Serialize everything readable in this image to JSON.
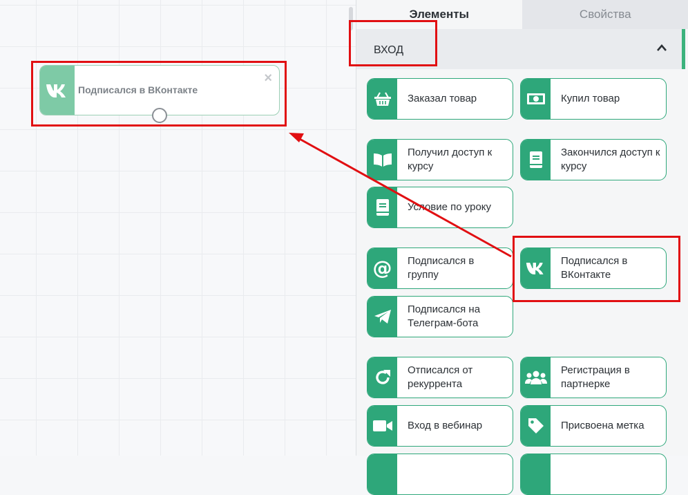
{
  "canvas": {
    "node": {
      "title": "Подписался в ВКонтакте",
      "icon": "vk-icon",
      "close": "×"
    }
  },
  "panel": {
    "tabs": [
      {
        "label": "Элементы",
        "active": true
      },
      {
        "label": "Свойства",
        "active": false
      }
    ],
    "section": {
      "title": "ВХОД",
      "chevron": "chevron-up-icon"
    },
    "cards": [
      {
        "label": "Заказал товар",
        "icon": "basket-icon"
      },
      {
        "label": "Купил товар",
        "icon": "money-icon"
      },
      {
        "label": "Получил доступ к курсу",
        "icon": "open-book-icon"
      },
      {
        "label": "Закончился доступ к курсу",
        "icon": "book-icon"
      },
      {
        "label": "Условие по уроку",
        "icon": "book-icon"
      },
      {
        "label": "Подписался в группу",
        "icon": "at-icon"
      },
      {
        "label": "Подписался в ВКонтакте",
        "icon": "vk-icon"
      },
      {
        "label": "Подписался на Телеграм-бота",
        "icon": "telegram-icon"
      },
      {
        "label": "Отписался от рекуррента",
        "icon": "redo-icon"
      },
      {
        "label": "Регистрация в партнерке",
        "icon": "users-icon"
      },
      {
        "label": "Вход в вебинар",
        "icon": "video-icon"
      },
      {
        "label": "Присвоена метка",
        "icon": "tag-icon"
      }
    ]
  },
  "colors": {
    "accent": "#2ea77a",
    "node_icon_bg": "#7ecaa6",
    "highlight": "#e10f12"
  }
}
